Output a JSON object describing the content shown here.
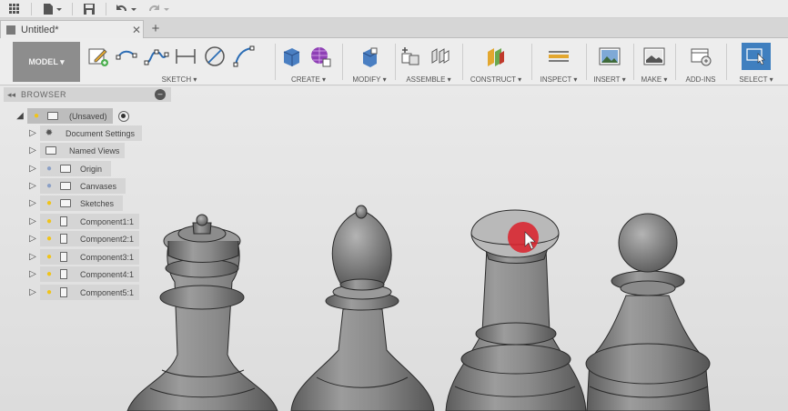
{
  "quick_access": {
    "icons": [
      "app-grid-icon",
      "file-menu-icon",
      "save-icon",
      "undo-icon",
      "redo-icon"
    ]
  },
  "document_tab": {
    "title": "Untitled*",
    "close_glyph": "✕",
    "new_tab_glyph": "+"
  },
  "ribbon": {
    "workspace_label": "MODEL ▾",
    "groups": [
      {
        "label": "SKETCH ▾"
      },
      {
        "label": "CREATE ▾"
      },
      {
        "label": "MODIFY ▾"
      },
      {
        "label": "ASSEMBLE ▾"
      },
      {
        "label": "CONSTRUCT ▾"
      },
      {
        "label": "INSPECT ▾"
      },
      {
        "label": "INSERT ▾"
      },
      {
        "label": "MAKE ▾"
      },
      {
        "label": "ADD-INS"
      },
      {
        "label": "SELECT ▾"
      }
    ]
  },
  "browser": {
    "title": "BROWSER",
    "collapse_glyph": "◂◂",
    "items": [
      {
        "label": "(Unsaved)"
      },
      {
        "label": "Document Settings"
      },
      {
        "label": "Named Views"
      },
      {
        "label": "Origin"
      },
      {
        "label": "Canvases"
      },
      {
        "label": "Sketches"
      },
      {
        "label": "Component1:1"
      },
      {
        "label": "Component2:1"
      },
      {
        "label": "Component3:1"
      },
      {
        "label": "Component4:1"
      },
      {
        "label": "Component5:1"
      }
    ]
  },
  "colors": {
    "accent_select": "#3f7fbf",
    "cursor_highlight": "#d9232e",
    "model_metal": "#8a8a8a"
  }
}
